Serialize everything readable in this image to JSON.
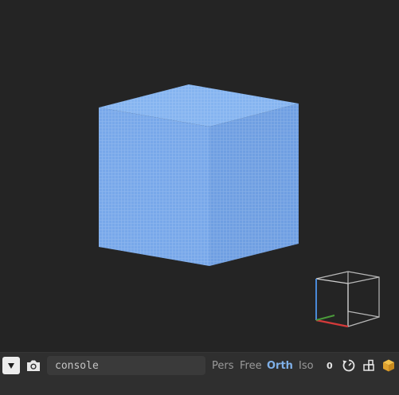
{
  "toolbar": {
    "console": {
      "placeholder": "console",
      "value": ""
    },
    "modes": [
      {
        "label": "Pers",
        "active": false
      },
      {
        "label": "Free",
        "active": false
      },
      {
        "label": "Orth",
        "active": true
      },
      {
        "label": "Iso",
        "active": false
      }
    ],
    "counter": "0",
    "icons": {
      "dropdown": "triangle-down-icon",
      "camera": "camera-icon",
      "reset_view": "rotate-reset-icon",
      "layout": "layout-icon",
      "cube": "cube-icon"
    }
  },
  "scene": {
    "object": "cube",
    "cube_color": "#7aaaea",
    "background": "#242424"
  },
  "view_gizmo": {
    "axis_colors": {
      "x": "#d33a3a",
      "y": "#4a9a3a",
      "z": "#4a8ad8"
    }
  }
}
